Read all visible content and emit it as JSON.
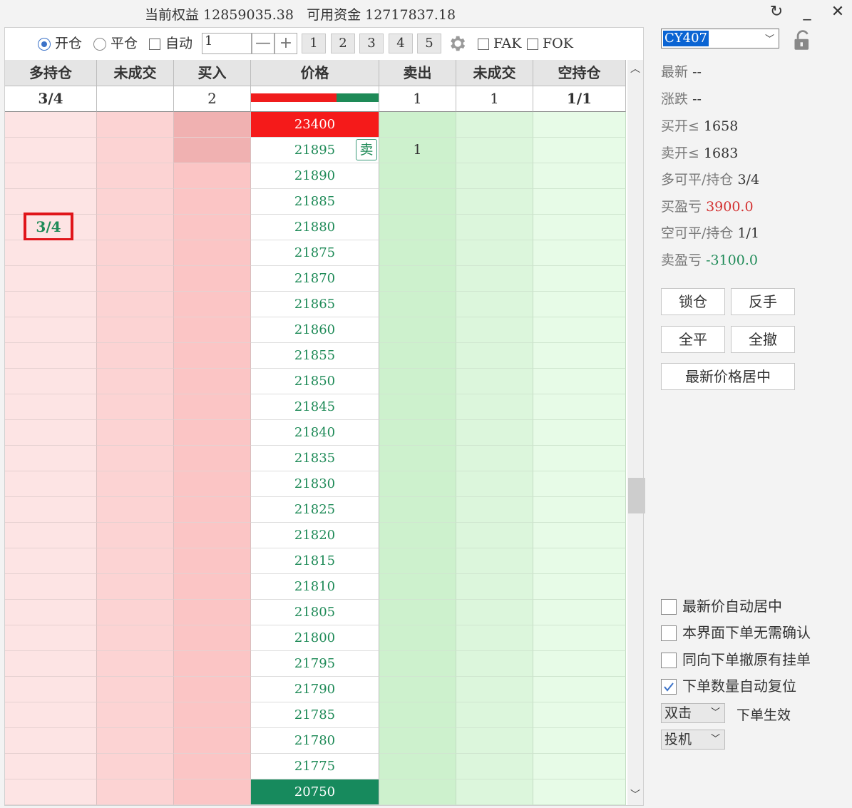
{
  "titlebar": {
    "info_text": "当前权益 12859035.38   可用资金 12717837.18",
    "refresh_icon": "↻",
    "minimize_icon": "_",
    "close_icon": "✕"
  },
  "toolbar": {
    "open_label": "开仓",
    "close_label": "平仓",
    "auto_label": "自动",
    "quantity_value": "1",
    "minus_label": "—",
    "plus_label": "+",
    "quick_qty": [
      "1",
      "2",
      "3",
      "4",
      "5"
    ],
    "fak_label": "FAK",
    "fok_label": "FOK"
  },
  "columns": [
    "多持仓",
    "未成交",
    "买入",
    "价格",
    "卖出",
    "未成交",
    "空持仓"
  ],
  "summary": {
    "long_position": "3/4",
    "long_pending": "",
    "buy": "2",
    "sell": "1",
    "short_pending": "1",
    "short_position": "1/1"
  },
  "ladder": {
    "prices": [
      "23400",
      "21895",
      "21890",
      "21885",
      "21880",
      "21875",
      "21870",
      "21865",
      "21860",
      "21855",
      "21850",
      "21845",
      "21840",
      "21835",
      "21830",
      "21825",
      "21820",
      "21815",
      "21810",
      "21805",
      "21800",
      "21795",
      "21790",
      "21785",
      "21780",
      "21775",
      "20750"
    ],
    "upper_limit": "23400",
    "lower_limit": "20750",
    "position_marker_price": "21880",
    "position_marker_text": "3/4",
    "sell_order_price": "21895",
    "sell_order_badge": "卖",
    "sell_order_qty": "1"
  },
  "right": {
    "contract": "CY407",
    "latest_label": "最新",
    "latest_value": "--",
    "change_label": "涨跌",
    "change_value": "--",
    "buy_open_label": "买开≤",
    "buy_open_value": "1658",
    "sell_open_label": "卖开≤",
    "sell_open_value": "1683",
    "long_close_label": "多可平/持仓",
    "long_close_value": "3/4",
    "buy_pnl_label": "买盈亏",
    "buy_pnl_value": "3900.0",
    "short_close_label": "空可平/持仓",
    "short_close_value": "1/1",
    "sell_pnl_label": "卖盈亏",
    "sell_pnl_value": "-3100.0",
    "lock_button": "锁仓",
    "reverse_button": "反手",
    "close_all_button": "全平",
    "cancel_all_button": "全撤",
    "center_button": "最新价格居中",
    "opt_auto_center": "最新价自动居中",
    "opt_no_confirm": "本界面下单无需确认",
    "opt_cancel_same": "同向下单撤原有挂单",
    "opt_reset_qty": "下单数量自动复位",
    "click_mode": "双击",
    "click_mode_label": "下单生效",
    "hedge_mode": "投机"
  },
  "colors": {
    "upper_limit_bg": "#f51a1a",
    "lower_limit_bg": "#178a5d",
    "price_text": "#1e8a57",
    "profit": "#d32f2f",
    "loss": "#1e8a57",
    "accent": "#3b72c8"
  }
}
